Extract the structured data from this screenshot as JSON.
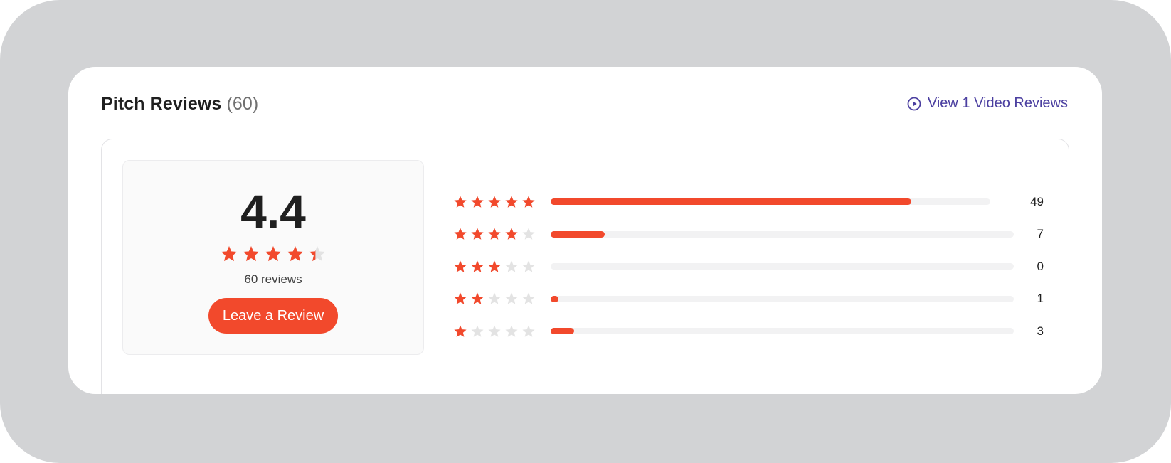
{
  "header": {
    "title": "Pitch Reviews",
    "count_text": "(60)",
    "video_link_label": "View 1 Video Reviews",
    "video_link_icon": "play-circle-icon"
  },
  "summary": {
    "average": "4.4",
    "average_value": 4.4,
    "max_stars": 5,
    "reviews_text": "60 reviews",
    "button_label": "Leave a Review"
  },
  "distribution": [
    {
      "stars": 5,
      "count": "49",
      "fill_fraction": 0.82
    },
    {
      "stars": 4,
      "count": "7",
      "fill_fraction": 0.117
    },
    {
      "stars": 3,
      "count": "0",
      "fill_fraction": 0
    },
    {
      "stars": 2,
      "count": "1",
      "fill_fraction": 0.017
    },
    {
      "stars": 1,
      "count": "3",
      "fill_fraction": 0.05
    }
  ],
  "colors": {
    "accent": "#f2492c",
    "star_empty": "#e3e3e3",
    "link": "#4b3fa0",
    "backdrop": "#d2d3d5"
  }
}
